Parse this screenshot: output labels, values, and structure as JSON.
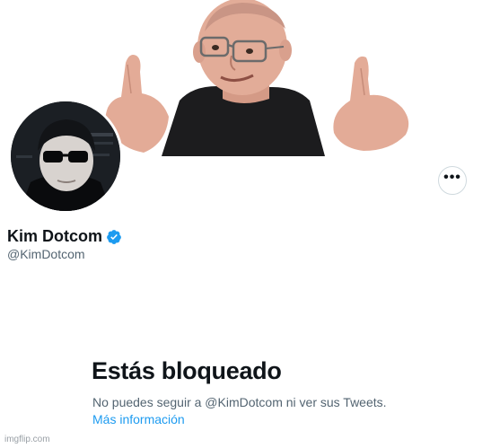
{
  "profile": {
    "display_name": "Kim Dotcom",
    "handle": "@KimDotcom",
    "verified": true,
    "more_options_label": "•••"
  },
  "blocked": {
    "title": "Estás bloqueado",
    "description": "No puedes seguir a @KimDotcom ni ver sus Tweets.",
    "link_label": "Más información"
  },
  "watermark": "imgflip.com",
  "colors": {
    "text_primary": "#0f1419",
    "text_secondary": "#536471",
    "link": "#1d9bf0",
    "verified_badge": "#1d9bf0"
  },
  "icons": {
    "verified": "verified-badge-icon",
    "more": "more-options-icon"
  }
}
